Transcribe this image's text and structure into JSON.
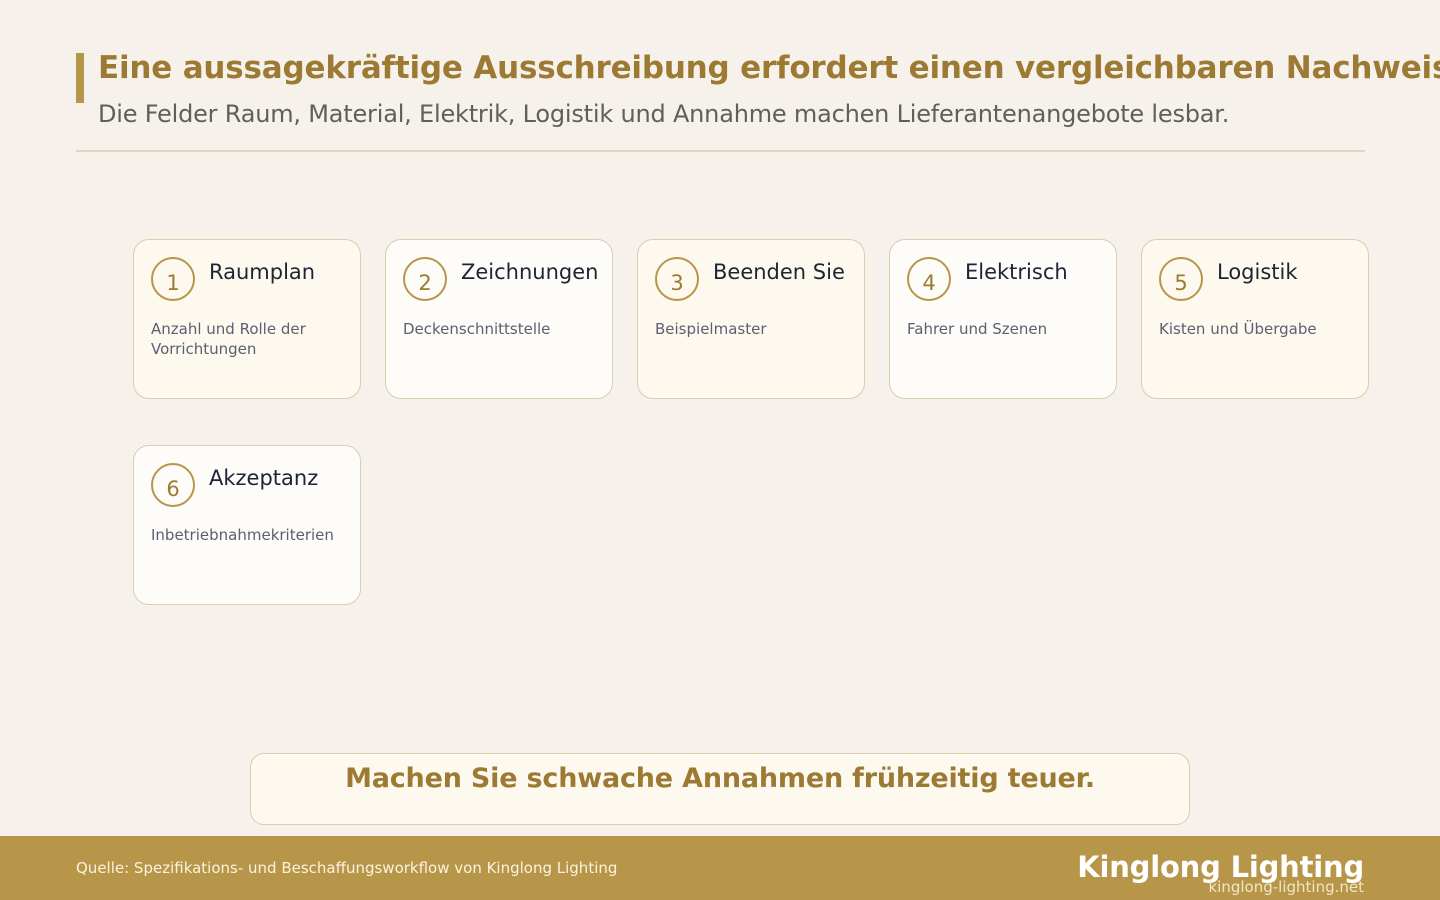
{
  "header": {
    "title": "Eine aussagekräftige Ausschreibung erfordert einen vergleichbaren Nachweis",
    "subtitle": "Die Felder Raum, Material, Elektrik, Logistik und Annahme machen Lieferantenangebote lesbar."
  },
  "steps": [
    {
      "number": "1",
      "title": "Raumplan",
      "description": "Anzahl und Rolle der Vorrichtungen"
    },
    {
      "number": "2",
      "title": "Zeichnungen",
      "description": "Deckenschnittstelle"
    },
    {
      "number": "3",
      "title": "Beenden Sie",
      "description": "Beispielmaster"
    },
    {
      "number": "4",
      "title": "Elektrisch",
      "description": "Fahrer und Szenen"
    },
    {
      "number": "5",
      "title": "Logistik",
      "description": "Kisten und Übergabe"
    },
    {
      "number": "6",
      "title": "Akzeptanz",
      "description": "Inbetriebnahmekriterien"
    }
  ],
  "callout": {
    "text": "Machen Sie schwache Annahmen frühzeitig teuer."
  },
  "footer": {
    "source": "Quelle: Spezifikations- und Beschaffungsworkflow von Kinglong Lighting",
    "brand": "Kinglong Lighting",
    "url": "kinglong-lighting.net"
  },
  "colors": {
    "accent": "#b89649",
    "accent_text": "#9d7a33",
    "background": "#f6f2eb"
  }
}
